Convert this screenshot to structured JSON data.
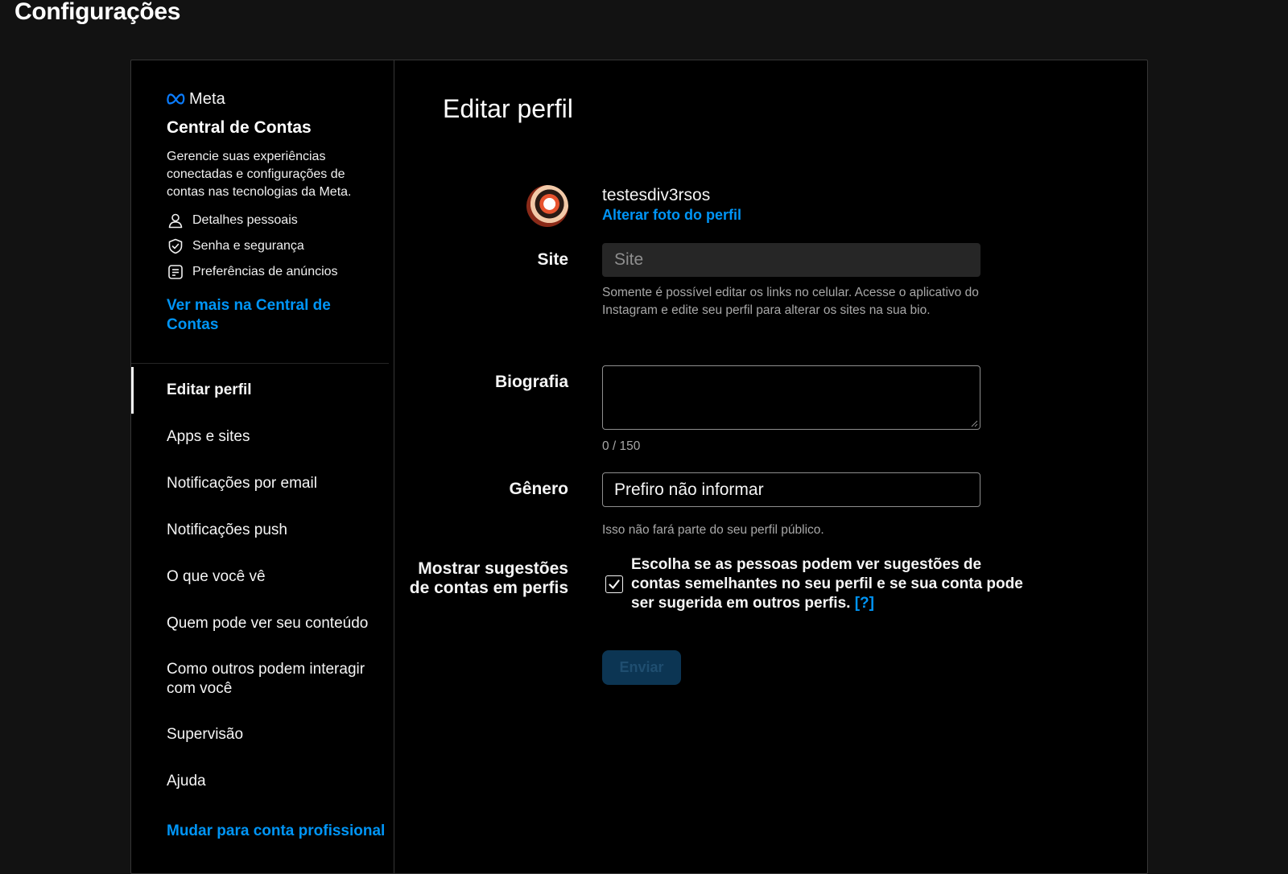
{
  "page": {
    "title": "Configurações"
  },
  "accounts_center": {
    "brand": "Meta",
    "title": "Central de Contas",
    "description": "Gerencie suas experiências conectadas e configurações de contas nas tecnologias da Meta.",
    "items": [
      {
        "label": "Detalhes pessoais",
        "icon": "person-icon"
      },
      {
        "label": "Senha e segurança",
        "icon": "shield-check-icon"
      },
      {
        "label": "Preferências de anúncios",
        "icon": "ad-preferences-icon"
      }
    ],
    "more_link": "Ver mais na Central de Contas"
  },
  "nav": {
    "items": [
      {
        "label": "Editar perfil",
        "active": true
      },
      {
        "label": "Apps e sites"
      },
      {
        "label": "Notificações por email"
      },
      {
        "label": "Notificações push"
      },
      {
        "label": "O que você vê"
      },
      {
        "label": "Quem pode ver seu conteúdo"
      },
      {
        "label": "Como outros podem interagir com você"
      },
      {
        "label": "Supervisão"
      },
      {
        "label": "Ajuda"
      },
      {
        "label": "Mudar para conta profissional"
      }
    ]
  },
  "edit_profile": {
    "title": "Editar perfil",
    "username": "testesdiv3rsos",
    "change_photo": "Alterar foto do perfil",
    "site": {
      "label": "Site",
      "placeholder": "Site",
      "help": "Somente é possível editar os links no celular. Acesse o aplicativo do Instagram e edite seu perfil para alterar os sites na sua bio."
    },
    "bio": {
      "label": "Biografia",
      "value": "",
      "counter": "0 / 150"
    },
    "gender": {
      "label": "Gênero",
      "value": "Prefiro não informar",
      "help": "Isso não fará parte do seu perfil público."
    },
    "suggestions": {
      "label": "Mostrar sugestões de contas em perfis",
      "checked": true,
      "text": "Escolha se as pessoas podem ver sugestões de contas semelhantes no seu perfil e se sua conta pode ser sugerida em outros perfis.",
      "help_link": "[?]"
    },
    "submit_label": "Enviar"
  },
  "colors": {
    "background": "#121212",
    "panel": "#000000",
    "accent": "#0095f6",
    "submit_disabled_bg": "#0c3553"
  }
}
